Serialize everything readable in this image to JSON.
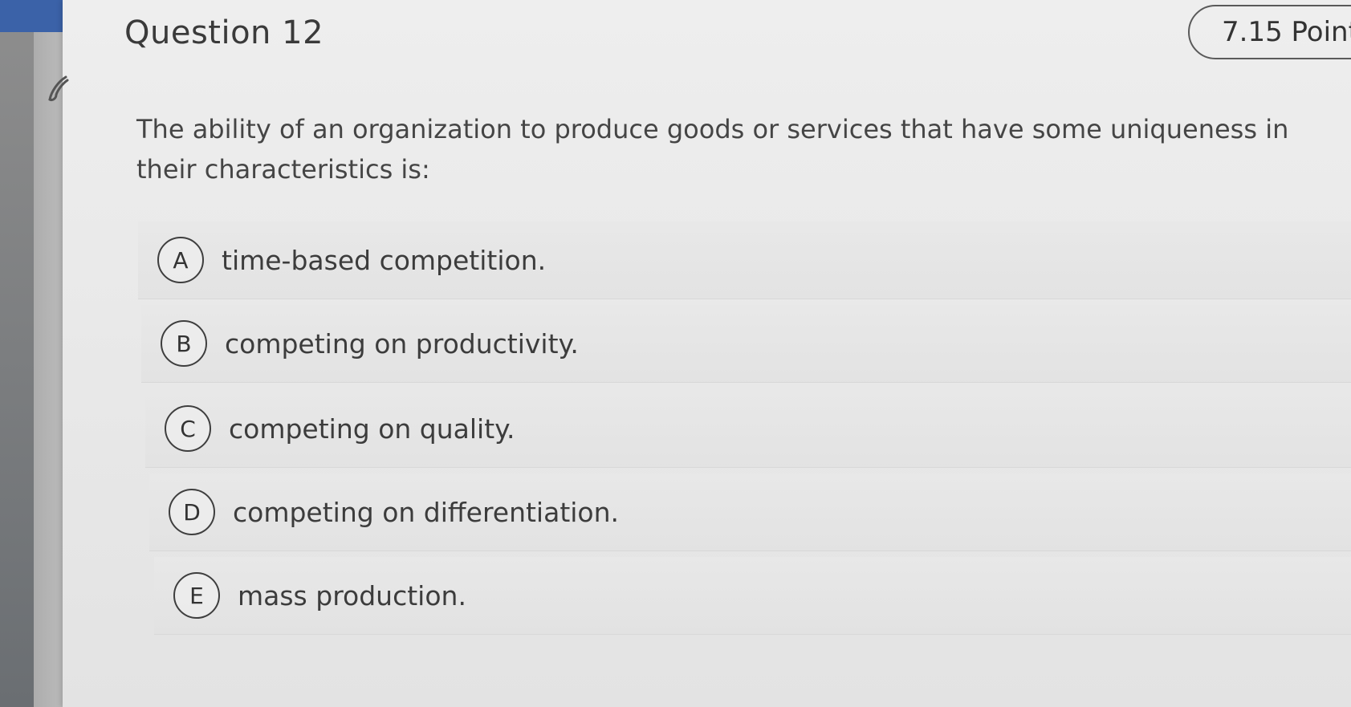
{
  "question": {
    "title": "Question 12",
    "points": "7.15 Point",
    "prompt": "The ability of an organization to produce goods or services that have some uniqueness in their characteristics is:"
  },
  "options": [
    {
      "letter": "A",
      "text": "time-based competition."
    },
    {
      "letter": "B",
      "text": "competing on productivity."
    },
    {
      "letter": "C",
      "text": "competing on quality."
    },
    {
      "letter": "D",
      "text": "competing on differentiation."
    },
    {
      "letter": "E",
      "text": "mass production."
    }
  ],
  "icons": {
    "flag": "flag-icon"
  }
}
